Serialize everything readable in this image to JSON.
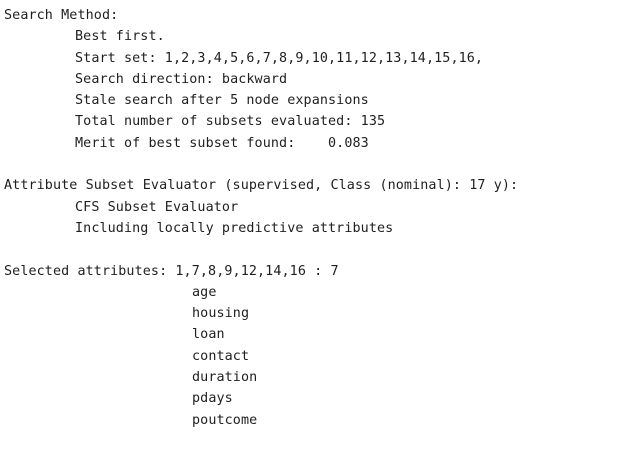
{
  "search_method": {
    "heading": "Search Method:",
    "lines": [
      "Best first.",
      "Start set: 1,2,3,4,5,6,7,8,9,10,11,12,13,14,15,16,",
      "Search direction: backward",
      "Stale search after 5 node expansions",
      "Total number of subsets evaluated: 135",
      "Merit of best subset found:    0.083"
    ]
  },
  "evaluator": {
    "heading": "Attribute Subset Evaluator (supervised, Class (nominal): 17 y):",
    "lines": [
      "CFS Subset Evaluator",
      "Including locally predictive attributes"
    ]
  },
  "selected": {
    "heading": "Selected attributes: 1,7,8,9,12,14,16 : 7",
    "attributes": [
      "age",
      "housing",
      "loan",
      "contact",
      "duration",
      "pdays",
      "poutcome"
    ]
  }
}
